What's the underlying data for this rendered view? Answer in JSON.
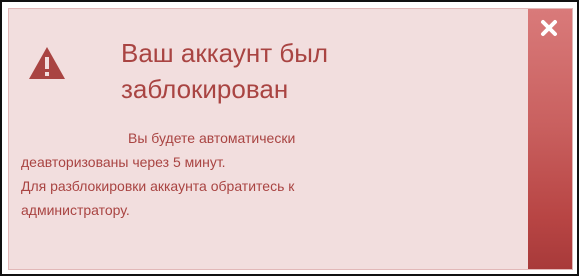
{
  "alert": {
    "title_line1": "Ваш аккаунт был",
    "title_line2": "заблокирован",
    "message_line1": "Вы будете автоматически",
    "message_line2": "деавторизованы через 5 минут.",
    "message_line3": "Для разблокировки аккаунта обратитесь к",
    "message_line4": "администратору.",
    "icon": "warning-triangle-icon",
    "close_icon": "close-icon"
  },
  "colors": {
    "background": "#f2dede",
    "text": "#a94442",
    "icon": "#a94442",
    "close_button": "#c9605f"
  }
}
